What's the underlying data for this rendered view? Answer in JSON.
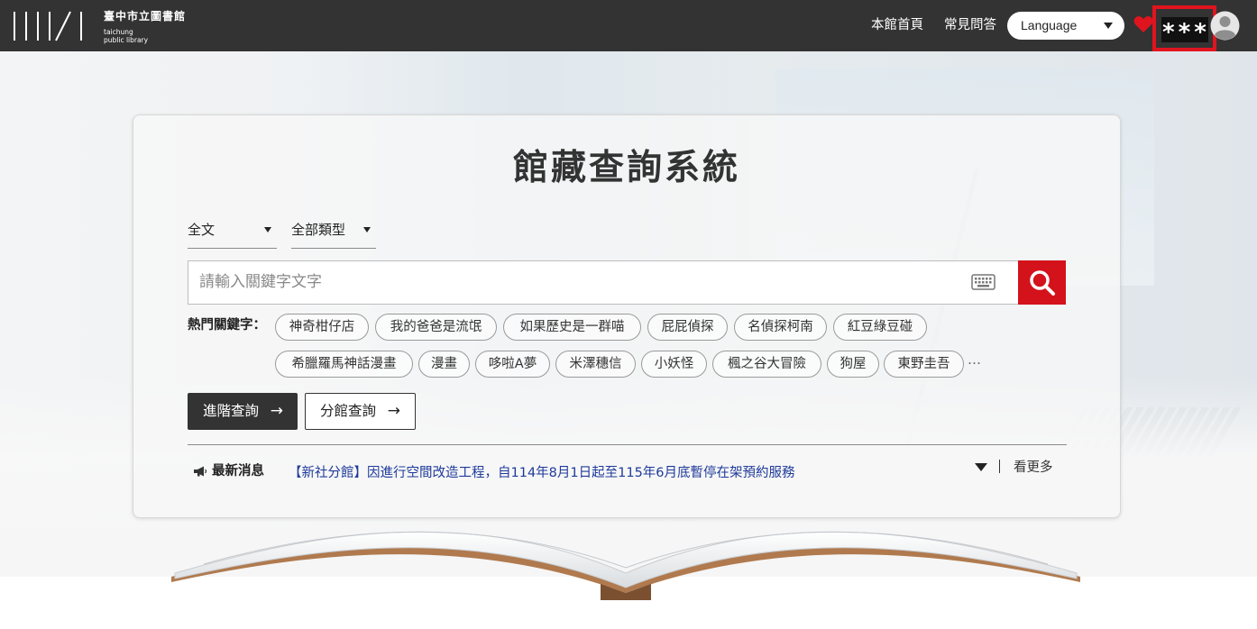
{
  "header": {
    "logo_zh": "臺中市立圖書館",
    "logo_en_1": "taichung",
    "logo_en_2": "public library",
    "nav": {
      "home": "本館首頁",
      "faq": "常見問答"
    },
    "language_select": "Language",
    "user_name_masked": "***"
  },
  "search": {
    "title": "館藏查詢系統",
    "field_select": "全文",
    "type_select": "全部類型",
    "placeholder": "請輸入關鍵字文字",
    "hot_keywords_label": "熱門關鍵字：",
    "hot_keywords_row1": [
      "神奇柑仔店",
      "我的爸爸是流氓",
      "如果歷史是一群喵",
      "屁屁偵探",
      "名偵探柯南",
      "紅豆綠豆碰"
    ],
    "hot_keywords_row2": [
      "希臘羅馬神話漫畫",
      "漫畫",
      "哆啦A夢",
      "米澤穗信",
      "小妖怪",
      "楓之谷大冒險",
      "狗屋",
      "東野圭吾"
    ],
    "ellipsis": "…",
    "advanced_button": "進階查詢",
    "branch_button": "分館查詢",
    "arrow": "→"
  },
  "news": {
    "label": "最新消息",
    "headline": "【新社分館】因進行空間改造工程，自114年8月1日起至115年6月底暫停在架預約服務",
    "more": "看更多"
  },
  "colors": {
    "topbar": "#333333",
    "accent_red": "#d4121b",
    "news_link": "#1e3a9a"
  }
}
